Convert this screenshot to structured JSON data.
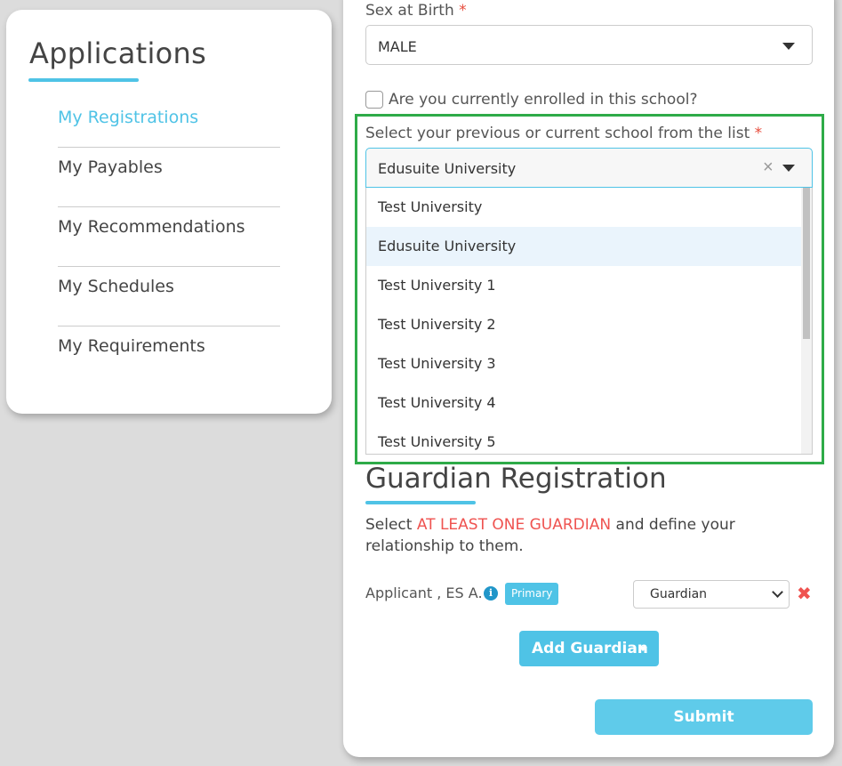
{
  "sidebar": {
    "title": "Applications",
    "items": [
      {
        "label": "My Registrations"
      },
      {
        "label": "My Payables"
      },
      {
        "label": "My Recommendations"
      },
      {
        "label": "My Schedules"
      },
      {
        "label": "My Requirements"
      }
    ]
  },
  "form": {
    "sex_label": "Sex at Birth",
    "required_mark": "*",
    "sex_value": "MALE",
    "enrolled_label": "Are you currently enrolled in this school?",
    "enrolled_checked": false,
    "school_label": "Select your previous or current school from the list",
    "school_value": "Edusuite University",
    "clear_symbol": "×",
    "school_options": [
      "Test University",
      "Edusuite University",
      "Test University 1",
      "Test University 2",
      "Test University 3",
      "Test University 4",
      "Test University 5"
    ],
    "selected_option_index": 1
  },
  "guardian": {
    "title": "Guardian Registration",
    "instr_prefix": "Select ",
    "instr_emphasis": "AT LEAST ONE GUARDIAN",
    "instr_suffix": " and define your relationship to them.",
    "applicant_name": "Applicant , ES A.",
    "info_symbol": "i",
    "primary_badge": "Primary",
    "relationship_value": "Guardian",
    "remove_symbol": "✖",
    "add_button": "Add Guardian"
  },
  "submit_label": "Submit",
  "colors": {
    "accent": "#4fc3e6",
    "highlight_border": "#2eab48",
    "required": "#e74c3c",
    "emphasis": "#ef5350"
  }
}
